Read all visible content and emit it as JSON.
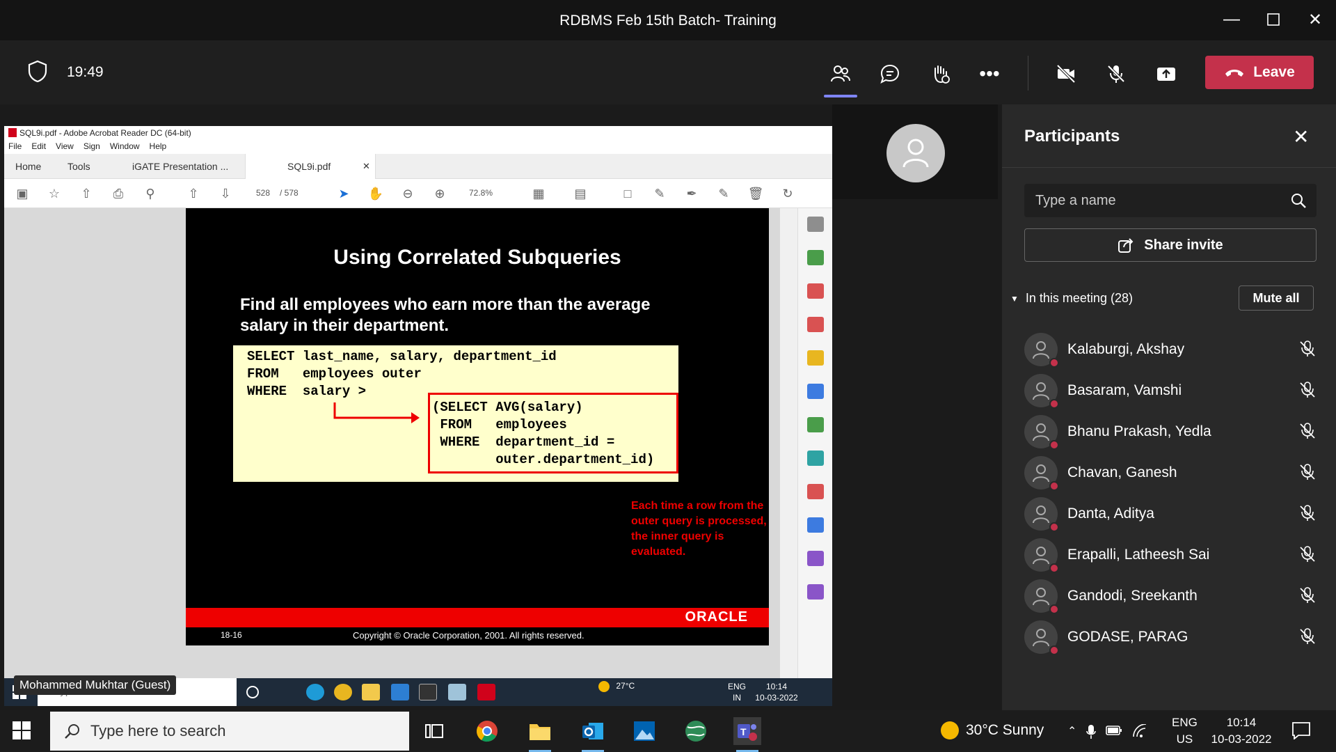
{
  "window": {
    "title": "RDBMS Feb 15th Batch- Training"
  },
  "meeting": {
    "timer": "19:49",
    "leave_label": "Leave"
  },
  "acrobat": {
    "window_title": "SQL9i.pdf - Adobe Acrobat Reader DC (64-bit)",
    "menu": [
      "File",
      "Edit",
      "View",
      "Sign",
      "Window",
      "Help"
    ],
    "tabs": {
      "home": "Home",
      "tools": "Tools",
      "presentation": "iGATE Presentation ...",
      "document": "SQL9i.pdf"
    },
    "page_current": "528",
    "page_total": "/ 578",
    "zoom": "72.8%"
  },
  "slide": {
    "title": "Using Correlated Subqueries",
    "subtitle": "Find all employees who earn more than the average salary in their department.",
    "outer_query": "SELECT last_name, salary, department_id\nFROM   employees outer\nWHERE  salary >",
    "inner_query": "(SELECT AVG(salary)\n FROM   employees\n WHERE  department_id =\n        outer.department_id)",
    "terminator": ";",
    "note": "Each time a row from the outer query is processed, the inner query is evaluated.",
    "brand": "ORACLE",
    "slide_number": "18-16",
    "copyright": "Copyright © Oracle Corporation, 2001. All rights reserved."
  },
  "inner_taskbar": {
    "search_placeholder": "Type here to search",
    "temperature": "27°C",
    "lang_1": "ENG",
    "lang_2": "IN",
    "time": "10:14",
    "date": "10-03-2022"
  },
  "presenter_label": "Mohammed Mukhtar (Guest)",
  "participants_panel": {
    "title": "Participants",
    "search_placeholder": "Type a name",
    "share_invite": "Share invite",
    "section_label": "In this meeting (28)",
    "mute_all": "Mute all",
    "people": [
      {
        "name": "Kalaburgi, Akshay"
      },
      {
        "name": "Basaram, Vamshi"
      },
      {
        "name": "Bhanu Prakash, Yedla"
      },
      {
        "name": "Chavan, Ganesh"
      },
      {
        "name": "Danta, Aditya"
      },
      {
        "name": "Erapalli, Latheesh Sai"
      },
      {
        "name": "Gandodi, Sreekanth"
      },
      {
        "name": "GODASE, PARAG"
      }
    ]
  },
  "taskbar": {
    "search_placeholder": "Type here to search",
    "weather": "30°C  Sunny",
    "lang_1": "ENG",
    "lang_2": "US",
    "time": "10:14",
    "date": "10-03-2022"
  },
  "colors": {
    "leave": "#c4314b",
    "slide_red": "#e00000",
    "code_bg": "#ffffcc",
    "active_indicator": "#7f85f5"
  }
}
